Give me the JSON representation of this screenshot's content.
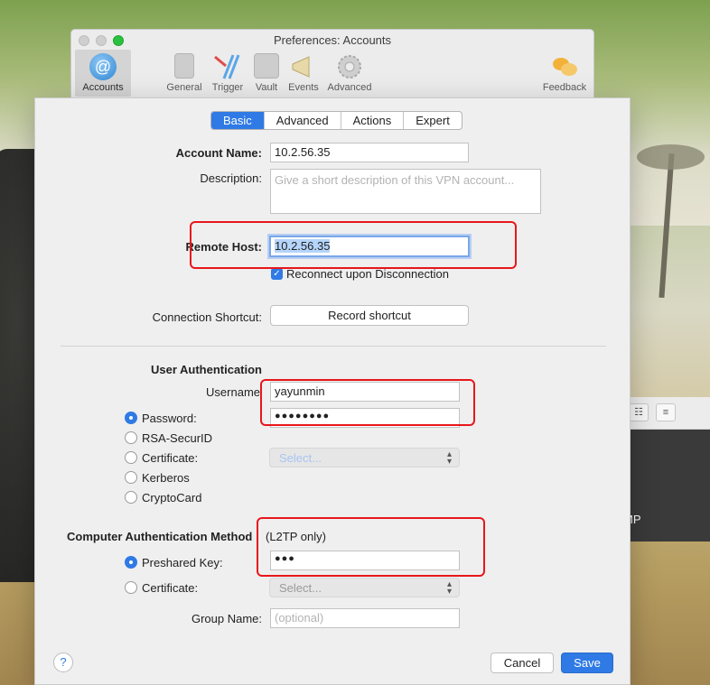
{
  "window": {
    "title": "Preferences: Accounts"
  },
  "toolbar": [
    {
      "label": "Accounts",
      "icon": "at-icon",
      "active": true
    },
    {
      "label": "General",
      "icon": "switch-icon"
    },
    {
      "label": "Trigger",
      "icon": "trigger-icon"
    },
    {
      "label": "Vault",
      "icon": "vault-icon"
    },
    {
      "label": "Events",
      "icon": "megaphone-icon"
    },
    {
      "label": "Advanced",
      "icon": "gear-icon"
    },
    {
      "label": "Feedback",
      "icon": "speech-bubbles-icon"
    }
  ],
  "tabs": [
    "Basic",
    "Advanced",
    "Actions",
    "Expert"
  ],
  "form": {
    "account_name_label": "Account Name:",
    "account_name_value": "10.2.56.35",
    "description_label": "Description:",
    "description_placeholder": "Give a short description of this VPN account...",
    "remote_host_label": "Remote Host:",
    "remote_host_value": "10.2.56.35",
    "reconnect_label": "Reconnect upon Disconnection",
    "connection_shortcut_label": "Connection Shortcut:",
    "record_shortcut_button": "Record shortcut",
    "user_auth_heading": "User Authentication",
    "username_label": "Username",
    "username_value": "yayunmin",
    "password_label": "Password:",
    "password_value": "●●●●●●●●",
    "rsa_label": "RSA-SecurID",
    "certificate_label": "Certificate:",
    "certificate_select": "Select...",
    "kerberos_label": "Kerberos",
    "cryptocard_label": "CryptoCard",
    "computer_auth_heading": "Computer Authentication Method",
    "computer_auth_note": "(L2TP only)",
    "preshared_label": "Preshared Key:",
    "preshared_value": "●●●",
    "certificate2_label": "Certificate:",
    "certificate2_select": "Select...",
    "group_name_label": "Group Name:",
    "group_name_placeholder": "(optional)"
  },
  "buttons": {
    "help": "?",
    "cancel": "Cancel",
    "save": "Save"
  },
  "background_window": {
    "text": "MP"
  },
  "colors": {
    "accent": "#2f7ae5",
    "annotation": "#e8161b"
  }
}
